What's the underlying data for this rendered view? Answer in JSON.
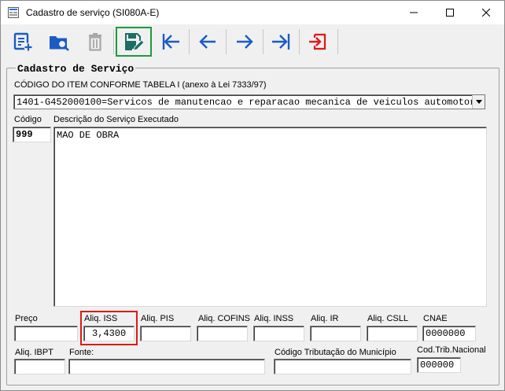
{
  "window": {
    "title": "Cadastro de serviço  (SI080A-E)"
  },
  "toolbar": {
    "buttons": [
      {
        "icon": "new-record-icon"
      },
      {
        "icon": "search-folder-icon"
      },
      {
        "icon": "delete-icon"
      },
      {
        "icon": "save-edit-icon",
        "active": true
      },
      {
        "icon": "first-record-icon"
      },
      {
        "icon": "previous-record-icon"
      },
      {
        "icon": "next-record-icon"
      },
      {
        "icon": "last-record-icon"
      },
      {
        "icon": "exit-icon"
      }
    ]
  },
  "form": {
    "group_title": "Cadastro de Serviço",
    "item_label": "CÓDIGO DO ITEM CONFORME TABELA I (anexo à Lei 7333/97)",
    "item_value": "1401-G452000100=Servicos de manutencao e reparacao mecanica de veiculos automotores",
    "codigo_label": "Código",
    "codigo_value": "999",
    "descricao_label": "Descrição do Serviço Executado",
    "descricao_value": "MAO DE OBRA",
    "preco_label": "Preço",
    "preco_value": "",
    "aliq_iss_label": "Aliq. ISS",
    "aliq_iss_value": "3,4300",
    "aliq_pis_label": "Aliq. PIS",
    "aliq_pis_value": "",
    "aliq_cofins_label": "Aliq. COFINS",
    "aliq_cofins_value": "",
    "aliq_inss_label": "Aliq. INSS",
    "aliq_inss_value": "",
    "aliq_ir_label": "Aliq. IR",
    "aliq_ir_value": "",
    "aliq_csll_label": "Aliq. CSLL",
    "aliq_csll_value": "",
    "cnae_label": "CNAE",
    "cnae_value": "0000000",
    "aliq_ibpt_label": "Aliq. IBPT",
    "aliq_ibpt_value": "",
    "fonte_label": "Fonte:",
    "fonte_value": "",
    "cod_trib_mun_label": "Código Tributação do Município",
    "cod_trib_mun_value": "",
    "cod_trib_nac_label": "Cod.Trib.Nacional",
    "cod_trib_nac_value": "000000"
  },
  "colors": {
    "accent_blue": "#1a5bc4",
    "active_border": "#1f9a3f",
    "highlight_red": "#e01818",
    "exit_red": "#e01818"
  }
}
